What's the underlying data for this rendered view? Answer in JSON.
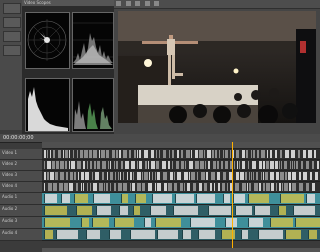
{
  "window": {
    "title": ""
  },
  "scopes": {
    "header": "Video Scopes",
    "vectorscope_label": "Vectorscope",
    "waveform_label": "Waveform",
    "histogram_label": "Histogram",
    "parade_label": "RGB Parade"
  },
  "preview": {
    "info": ""
  },
  "timeline": {
    "timecode": "00:00:00;00",
    "tracks": [
      {
        "name": "Video 1"
      },
      {
        "name": "Video 2"
      },
      {
        "name": "Video 3"
      },
      {
        "name": "Video 4"
      },
      {
        "name": "Audio 1"
      },
      {
        "name": "Audio 2"
      },
      {
        "name": "Audio 3"
      },
      {
        "name": "Audio 4"
      }
    ]
  },
  "colors": {
    "clip_gray": "#8c8c8c",
    "clip_light": "#d0d0d0",
    "audio_cyan": "#3f8f9a",
    "audio_yellow": "#c8c050",
    "audio_wave": "#e0e0e0",
    "cursor": "#ffb000"
  }
}
